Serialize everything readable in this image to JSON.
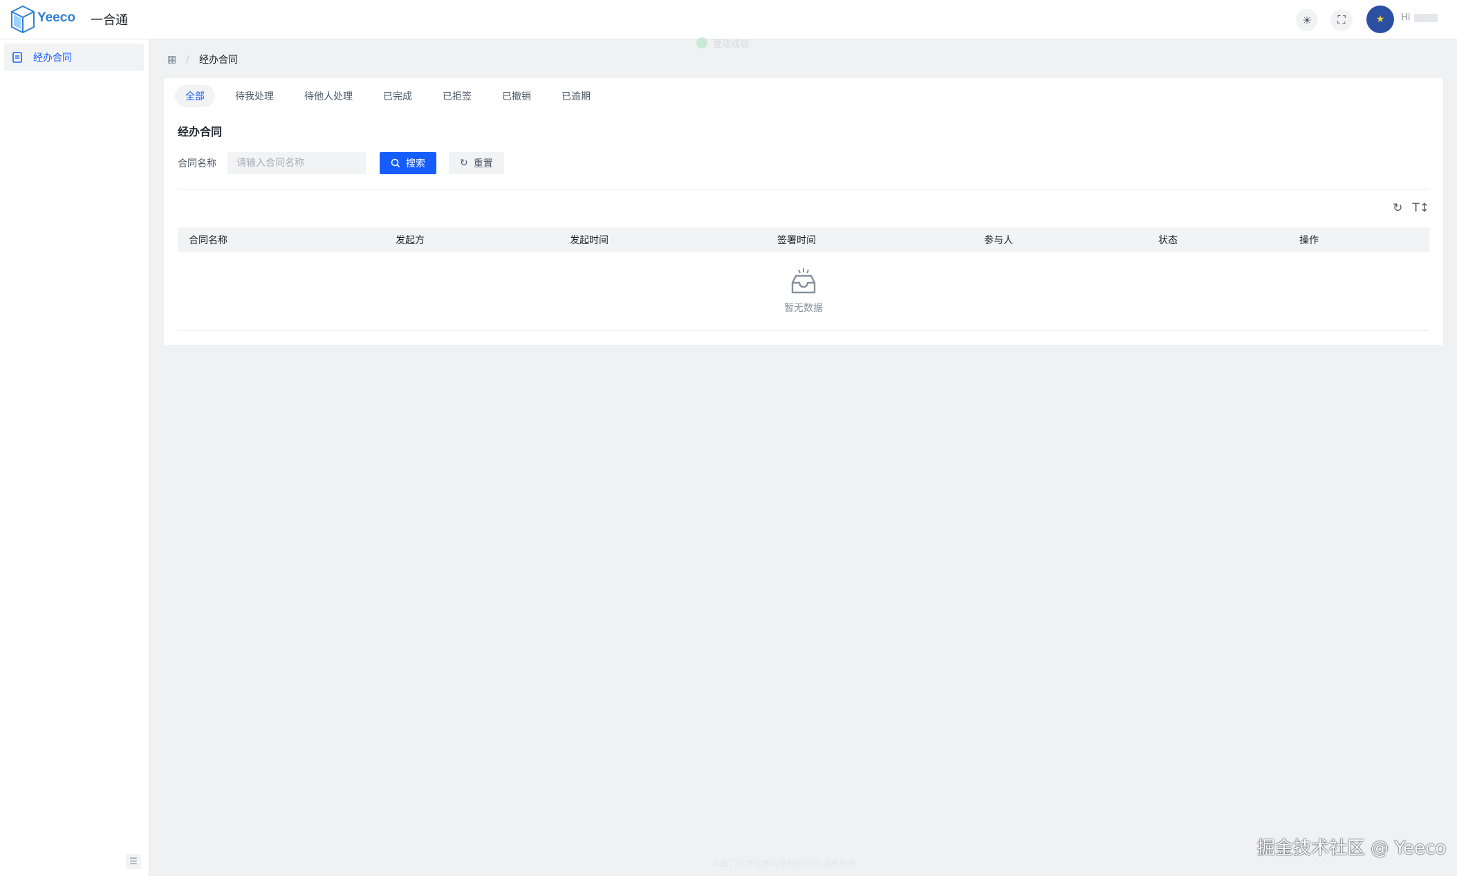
{
  "header": {
    "logo_text": "Yeeco",
    "app_name": "一合通",
    "toast": "登陆成功",
    "greeting": "Hi"
  },
  "icons": {
    "theme": "sun-icon",
    "fullscreen": "fullscreen-icon",
    "avatar": "star-icon",
    "menu_doc": "document-icon",
    "collapse": "collapse-icon",
    "breadcrumb_home": "grid-icon",
    "search": "search-icon",
    "reset": "refresh-icon",
    "table_refresh": "refresh-icon",
    "table_density": "text-size-icon",
    "empty": "empty-inbox-icon"
  },
  "sidebar": {
    "items": [
      {
        "label": "经办合同",
        "active": true
      }
    ]
  },
  "breadcrumb": {
    "current": "经办合同"
  },
  "tabs": [
    {
      "label": "全部",
      "active": true
    },
    {
      "label": "待我处理"
    },
    {
      "label": "待他人处理"
    },
    {
      "label": "已完成"
    },
    {
      "label": "已拒签"
    },
    {
      "label": "已撤销"
    },
    {
      "label": "已逾期"
    }
  ],
  "main": {
    "title": "经办合同",
    "filter": {
      "label": "合同名称",
      "placeholder": "请输入合同名称",
      "value": "",
      "search_label": "搜索",
      "reset_label": "重置"
    },
    "table": {
      "columns": [
        "合同名称",
        "发起方",
        "发起时间",
        "签署时间",
        "参与人",
        "状态",
        "操作"
      ],
      "rows": [],
      "empty_text": "暂无数据"
    }
  },
  "footer": {
    "text": "©厦门亿合信息科技有限公司 版权所有"
  },
  "watermark": "掘金技术社区 @ Yeeco",
  "colors": {
    "primary": "#165dff",
    "avatar_bg": "#2b4fa3",
    "bg": "#f0f1f3"
  }
}
